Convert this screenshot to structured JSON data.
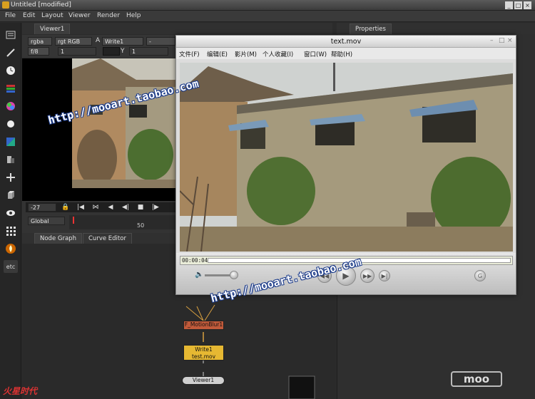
{
  "window": {
    "title": "Untitled [modified]"
  },
  "menubar": {
    "items": [
      "File",
      "Edit",
      "Layout",
      "Viewer",
      "Render",
      "Help"
    ]
  },
  "toolbar": {
    "icons": [
      "viewer-icon",
      "paint-brush-icon",
      "clock-icon",
      "color-bars-icon",
      "color-wheel-icon",
      "circle-icon",
      "keyer-icon",
      "merge-icon",
      "transform-icon",
      "3d-cube-icon",
      "eye-icon",
      "grid-icon",
      "fire-icon",
      "etc-icon"
    ],
    "etc_label": "etc"
  },
  "viewer": {
    "tab": "Viewer1",
    "channels": "rgba",
    "colorspace": "rgt RGB",
    "alpha_label": "A",
    "input_node": "Write1",
    "b_input": "-",
    "fstop": "f/8",
    "gain": "1",
    "y_label": "Y",
    "gamma": "1",
    "frame": "-27",
    "range_scope": "Global",
    "timeline_mark": "50"
  },
  "nodegraph": {
    "tabs": [
      "Node Graph",
      "Curve Editor"
    ]
  },
  "properties": {
    "tab": "Properties"
  },
  "nodes": {
    "motionblur": "F_MotionBlur1",
    "write": "Write1",
    "write_file": "test.mov",
    "viewer": "Viewer1"
  },
  "quicktime": {
    "title": "text.mov",
    "menu": [
      "文件(F)",
      "编辑(E)",
      "影片(M)",
      "个人收藏(I)",
      "窗口(W)",
      "帮助(H)"
    ],
    "timecode": "00:00:04"
  },
  "watermarks": [
    "http://mooart.taobao.com",
    "http://mooart.taobao.com",
    "http://mooart.taobao.com"
  ],
  "logos": {
    "bottom_left": "火星时代",
    "bottom_right": "moo"
  }
}
